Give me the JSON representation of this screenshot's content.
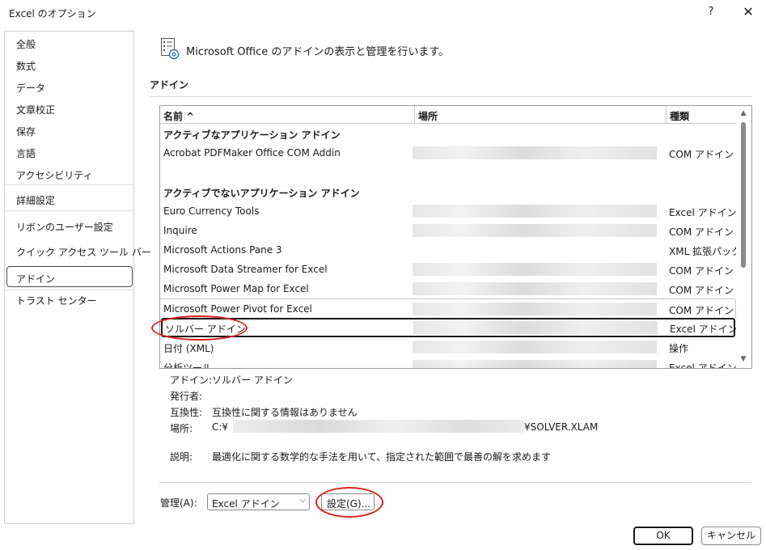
{
  "window": {
    "title": "Excel のオプション",
    "help_glyph": "?",
    "close_glyph": "✕"
  },
  "sidebar": {
    "items": [
      {
        "label": "全般"
      },
      {
        "label": "数式"
      },
      {
        "label": "データ"
      },
      {
        "label": "文章校正"
      },
      {
        "label": "保存"
      },
      {
        "label": "言語"
      },
      {
        "label": "アクセシビリティ"
      },
      {
        "label": "詳細設定"
      },
      {
        "label": "リボンのユーザー設定"
      },
      {
        "label": "クイック アクセス ツール バー"
      },
      {
        "label": "アドイン"
      },
      {
        "label": "トラスト センター"
      }
    ],
    "selected": "アドイン"
  },
  "header": {
    "icon": "addin-settings-icon",
    "text": "Microsoft Office のアドインの表示と管理を行います。"
  },
  "section": {
    "label": "アドイン"
  },
  "table": {
    "columns": [
      "名前 ^",
      "場所",
      "種類"
    ],
    "rows": [
      {
        "kind": "group",
        "name": "アクティブなアプリケーション アドイン",
        "type": ""
      },
      {
        "kind": "item",
        "name": "Acrobat PDFMaker Office COM Addin",
        "type": "COM アドイン"
      },
      {
        "kind": "spacer",
        "name": "",
        "type": ""
      },
      {
        "kind": "group",
        "name": "アクティブでないアプリケーション アドイン",
        "type": ""
      },
      {
        "kind": "item",
        "name": "Euro Currency Tools",
        "type": "Excel アドイン"
      },
      {
        "kind": "item",
        "name": "Inquire",
        "type": "COM アドイン"
      },
      {
        "kind": "item",
        "name": "Microsoft Actions Pane 3",
        "type": "XML 拡張パック"
      },
      {
        "kind": "item",
        "name": "Microsoft Data Streamer for Excel",
        "type": "COM アドイン"
      },
      {
        "kind": "item",
        "name": "Microsoft Power Map for Excel",
        "type": "COM アドイン"
      },
      {
        "kind": "item",
        "name": "Microsoft Power Pivot for Excel",
        "type": "COM アドイン"
      },
      {
        "kind": "item",
        "name": "ソルバー アドイン",
        "type": "Excel アドイン",
        "selected": true
      },
      {
        "kind": "item",
        "name": "日付 (XML)",
        "type": "操作"
      },
      {
        "kind": "item",
        "name": "分析ツール",
        "type": "Excel アドイン"
      }
    ]
  },
  "details": {
    "addin_label": "アドイン:",
    "addin_value": "ソルバー アドイン",
    "publisher_label": "発行者:",
    "publisher_value": "",
    "compat_label": "互換性:",
    "compat_value": "互換性に関する情報はありません",
    "location_label": "場所:",
    "location_prefix": "C:¥",
    "location_suffix": "¥SOLVER.XLAM",
    "desc_label": "説明:",
    "desc_value": "最適化に関する数学的な手法を用いて、指定された範囲で最善の解を求めます"
  },
  "manage": {
    "label": "管理(A):",
    "selected": "Excel アドイン",
    "go_label": "設定(G)..."
  },
  "buttons": {
    "ok": "OK",
    "cancel": "キャンセル"
  },
  "colors": {
    "annotation": "#d8231f"
  }
}
